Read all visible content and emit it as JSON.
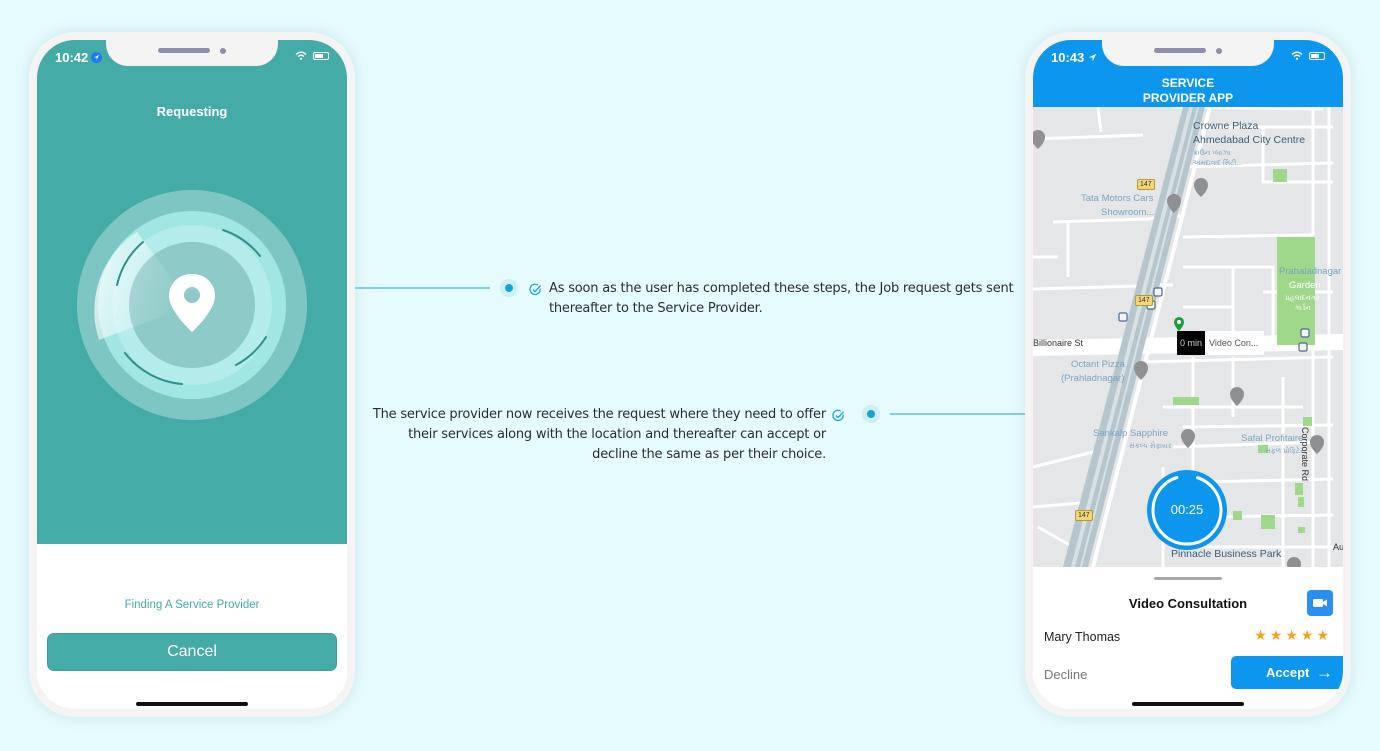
{
  "left_phone": {
    "status_time": "10:42",
    "title": "Requesting",
    "finding_text": "Finding A Service Provider",
    "cancel_label": "Cancel",
    "colors": {
      "primary": "#44aba7"
    }
  },
  "annotations": [
    {
      "text_line1": "As soon as the user has completed these steps, the Job request gets sent",
      "text_line2": "thereafter to the Service Provider."
    },
    {
      "text_line1": "The service provider now receives the request where they need to offer",
      "text_line2": "their services along with the location and thereafter can accept or",
      "text_line3": "decline the same as per their choice."
    }
  ],
  "right_phone": {
    "status_time": "10:43",
    "header_line1": "SERVICE",
    "header_line2": "PROVIDER APP",
    "map": {
      "labels": {
        "crowne_1": "Crowne Plaza",
        "crowne_2": "Ahmedabad City Centre",
        "crowne_3": "ક્રાઉન પ્લાઝા",
        "crowne_4": "અમદાવાદ સિટી...",
        "tata_1": "Tata Motors Cars",
        "tata_2": "Showroom...",
        "garden_1": "Prahaladnagar",
        "garden_2": "Garden",
        "garden_3": "પ્રહલાદનગર",
        "garden_4": "ગાર્ડન",
        "billionaire": "Billionaire St",
        "octant_1": "Octant Pizza",
        "octant_2": "(Prahladnagar)",
        "sankalp_1": "Sankalp Sapphire",
        "sankalp_2": "સંકલ્પ સેફાયર",
        "safal_1": "Safal Profitaire",
        "safal_2": "સફળ પ્રોફિટેર",
        "corporate": "Corporate Rd",
        "pinnacle": "Pinnacle Business Park",
        "road_number": "147",
        "edge_label": "Au"
      },
      "eta_min": "0 min",
      "eta_label": "Video Con..."
    },
    "timer": "00:25",
    "timer_progress": 0.9,
    "sheet": {
      "title": "Video Consultation",
      "customer_name": "Mary Thomas",
      "rating": 5,
      "rating_max": 5,
      "decline_label": "Decline",
      "accept_label": "Accept"
    },
    "colors": {
      "primary": "#0d96ee",
      "star": "#f6a31c"
    }
  }
}
